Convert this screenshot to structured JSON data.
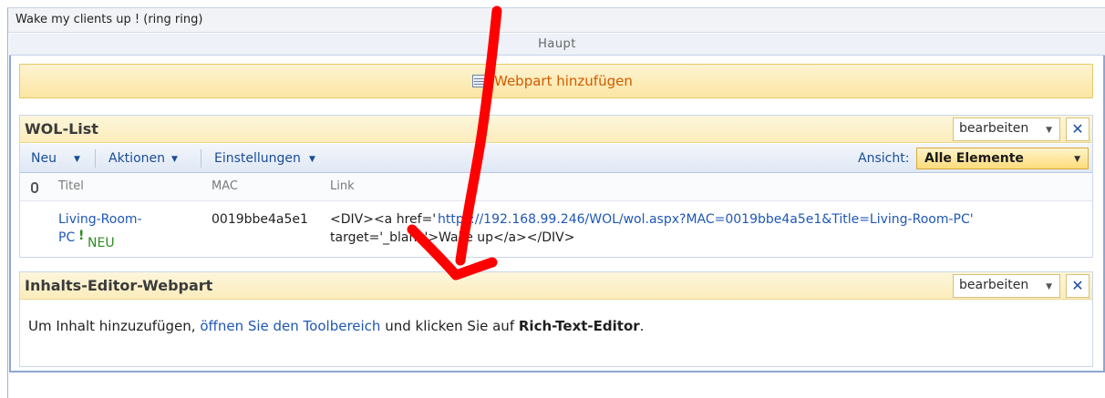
{
  "window": {
    "title": "Wake my clients up ! (ring ring)"
  },
  "zone": {
    "title": "Haupt",
    "add_webpart_label": "Webpart hinzufügen"
  },
  "wol_list": {
    "title": "WOL-List",
    "edit_label": "bearbeiten",
    "close_glyph": "✕",
    "toolbar": {
      "new_label": "Neu",
      "actions_label": "Aktionen",
      "settings_label": "Einstellungen",
      "view_label": "Ansicht:",
      "view_value": "Alle Elemente"
    },
    "columns": [
      "Titel",
      "MAC",
      "Link"
    ],
    "rows": [
      {
        "title_line1": "Living-Room-",
        "title_line2": "PC",
        "new_badge": "NEU",
        "mac": "0019bbe4a5e1",
        "link_prefix": "<DIV><a href='",
        "link_url": "https://192.168.99.246/WOL/wol.aspx?MAC=0019bbe4a5e1&Title=Living-Room-PC'",
        "link_line2": "target='_blank'>Wake up</a></DIV>"
      }
    ]
  },
  "content_editor": {
    "title": "Inhalts-Editor-Webpart",
    "edit_label": "bearbeiten",
    "close_glyph": "✕",
    "text_before": "Um Inhalt hinzuzufügen, ",
    "text_link": "öffnen Sie den Toolbereich",
    "text_middle": " und klicken Sie auf ",
    "text_bold": "Rich-Text-Editor",
    "text_after": "."
  },
  "colors": {
    "annotation_arrow": "#ff0000",
    "link": "#1f57b5",
    "header_gold": "#fbecbb"
  }
}
